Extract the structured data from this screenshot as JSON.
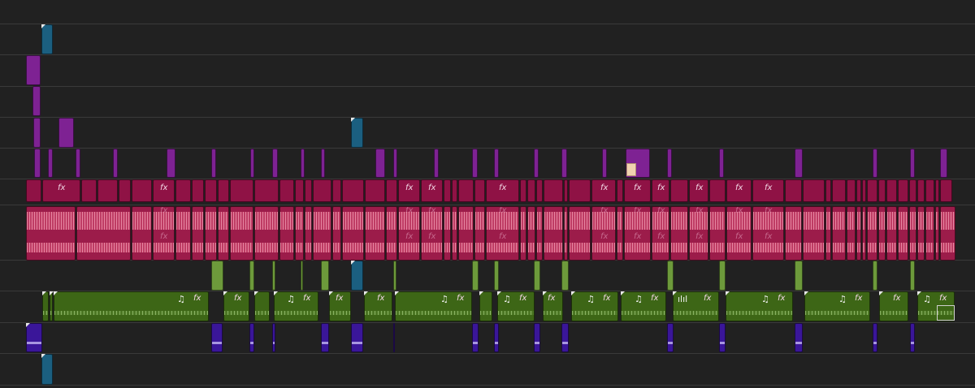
{
  "timeline": {
    "name": "timeline-tracks",
    "fx_label": "fx",
    "music_label": "♫",
    "wave_label": "ılıl",
    "colors": {
      "background": "#212121",
      "track_line": "#3a3a3a",
      "video_blue": "#1b5f80",
      "video_purple": "#7e2293",
      "video_red": "#8f1245",
      "audio_pink": "#9c1c4a",
      "audio_green": "#3d6616",
      "audio_indigo": "#3a1699"
    }
  }
}
